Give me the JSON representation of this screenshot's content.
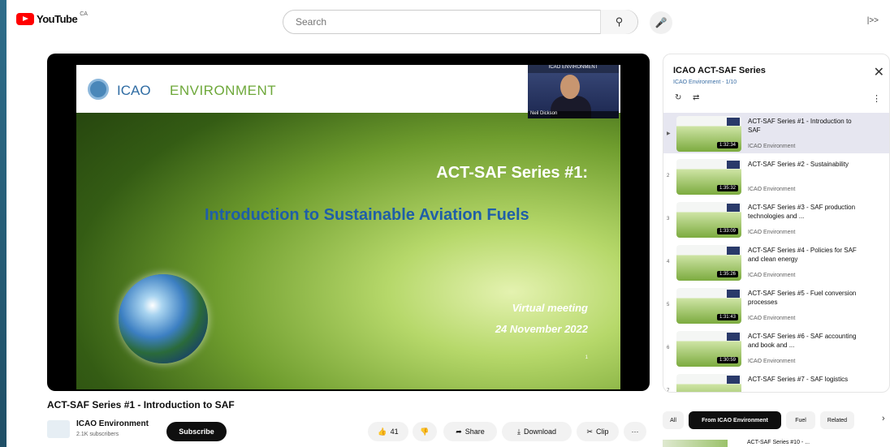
{
  "header": {
    "logo_text": "YouTube",
    "country_code": "CA",
    "search_placeholder": "Search",
    "right_text": "|>>"
  },
  "slide": {
    "org": "ICAO",
    "org_section": "ENVIRONMENT",
    "speaker_caption": "Neil Dickson",
    "speaker_logo": "ICAO ENVIRONMENT",
    "title_line1": "ACT-SAF Series #1:",
    "title_line2": "Introduction to Sustainable Aviation Fuels",
    "subtitle_line1": "Virtual meeting",
    "subtitle_line2": "24 November 2022",
    "page_number": "1"
  },
  "video": {
    "title": "ACT-SAF Series #1 - Introduction to SAF",
    "channel_name": "ICAO Environment",
    "subscribers": "2.1K subscribers",
    "subscribe_label": "Subscribe",
    "like_label": "41",
    "share_label": "Share",
    "download_label": "Download",
    "clip_label": "Clip",
    "more_label": "···"
  },
  "playlist": {
    "title": "ICAO ACT-SAF Series",
    "subtitle": "ICAO Environment - 1/10",
    "items": [
      {
        "index": "▶",
        "title": "ACT-SAF Series #1 - Introduction to SAF",
        "channel": "ICAO Environment",
        "duration": "1:32:34"
      },
      {
        "index": "2",
        "title": "ACT-SAF Series #2 - Sustainability",
        "channel": "ICAO Environment",
        "duration": "1:35:32"
      },
      {
        "index": "3",
        "title": "ACT-SAF Series #3 - SAF production technologies and ...",
        "channel": "ICAO Environment",
        "duration": "1:33:09"
      },
      {
        "index": "4",
        "title": "ACT-SAF Series #4 - Policies for SAF and clean energy",
        "channel": "ICAO Environment",
        "duration": "1:35:26"
      },
      {
        "index": "5",
        "title": "ACT-SAF Series #5 - Fuel conversion processes",
        "channel": "ICAO Environment",
        "duration": "1:31:43"
      },
      {
        "index": "6",
        "title": "ACT-SAF Series #6 - SAF accounting and book and ...",
        "channel": "ICAO Environment",
        "duration": "1:30:59"
      },
      {
        "index": "7",
        "title": "ACT-SAF Series #7 - SAF logistics",
        "channel": "ICAO Environment",
        "duration": ""
      }
    ]
  },
  "chips": {
    "all": "All",
    "from_channel": "From ICAO Environment",
    "fuel": "Fuel",
    "related": "Related"
  },
  "recommendation": {
    "title": "ACT-SAF Series #10 - ..."
  },
  "colors": {
    "brand_red": "#ff0000",
    "slide_title_blue": "#1f5ea8"
  }
}
